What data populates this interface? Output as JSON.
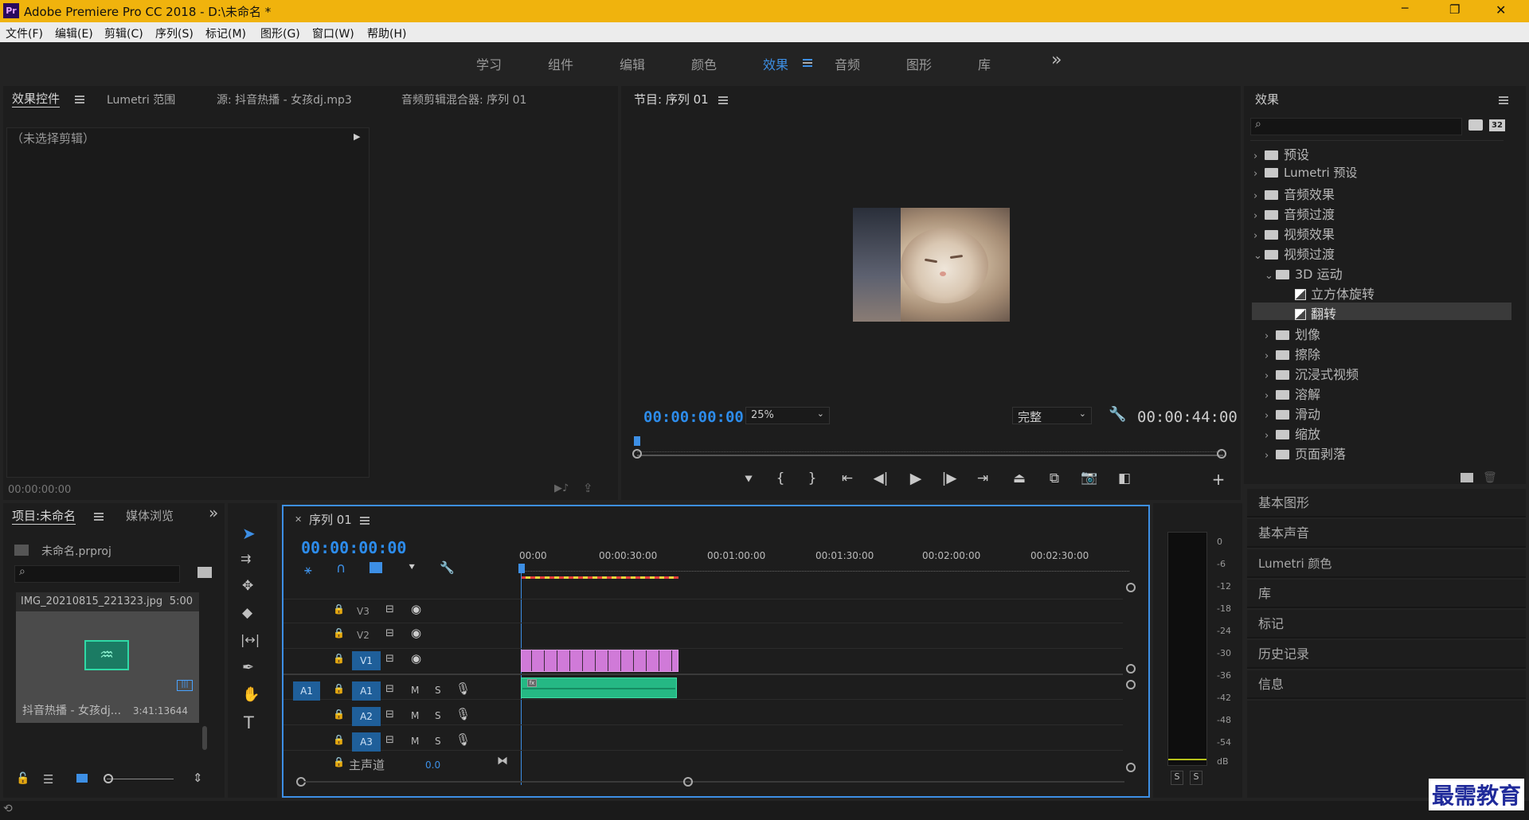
{
  "window": {
    "title": "Adobe Premiere Pro CC 2018 - D:\\未命名 *",
    "app_icon": "Pr",
    "controls": {
      "minimize": "─",
      "maximize": "❐",
      "close": "✕"
    }
  },
  "menu": [
    "文件(F)",
    "编辑(E)",
    "剪辑(C)",
    "序列(S)",
    "标记(M)",
    "图形(G)",
    "窗口(W)",
    "帮助(H)"
  ],
  "workspaces": {
    "items": [
      "学习",
      "组件",
      "编辑",
      "颜色",
      "效果",
      "音频",
      "图形",
      "库"
    ],
    "active": "效果",
    "more": "»"
  },
  "effect_controls": {
    "tabs": [
      "效果控件",
      "Lumetri 范围",
      "源: 抖音热播 - 女孩dj.mp3",
      "音频剪辑混合器: 序列 01"
    ],
    "no_clip": "（未选择剪辑）",
    "timecode": "00:00:00:00"
  },
  "program": {
    "title": "节目: 序列 01",
    "timecode": "00:00:00:00",
    "zoom": "25%",
    "quality": "完整",
    "duration": "00:00:44:00"
  },
  "effects_panel": {
    "title": "效果",
    "tree": [
      {
        "label": "预设",
        "level": 0,
        "type": "folder",
        "open": false
      },
      {
        "label": "Lumetri 预设",
        "level": 0,
        "type": "folder",
        "open": false
      },
      {
        "label": "音频效果",
        "level": 0,
        "type": "folder",
        "open": false
      },
      {
        "label": "音频过渡",
        "level": 0,
        "type": "folder",
        "open": false
      },
      {
        "label": "视频效果",
        "level": 0,
        "type": "folder",
        "open": false
      },
      {
        "label": "视频过渡",
        "level": 0,
        "type": "folder",
        "open": true
      },
      {
        "label": "3D 运动",
        "level": 1,
        "type": "folder",
        "open": true
      },
      {
        "label": "立方体旋转",
        "level": 2,
        "type": "effect"
      },
      {
        "label": "翻转",
        "level": 2,
        "type": "effect",
        "selected": true
      },
      {
        "label": "划像",
        "level": 1,
        "type": "folder",
        "open": false
      },
      {
        "label": "擦除",
        "level": 1,
        "type": "folder",
        "open": false
      },
      {
        "label": "沉浸式视频",
        "level": 1,
        "type": "folder",
        "open": false
      },
      {
        "label": "溶解",
        "level": 1,
        "type": "folder",
        "open": false
      },
      {
        "label": "滑动",
        "level": 1,
        "type": "folder",
        "open": false
      },
      {
        "label": "缩放",
        "level": 1,
        "type": "folder",
        "open": false
      },
      {
        "label": "页面剥落",
        "level": 1,
        "type": "folder",
        "open": false
      }
    ],
    "badges": [
      "32"
    ]
  },
  "side_panels": [
    "基本图形",
    "基本声音",
    "Lumetri 颜色",
    "库",
    "标记",
    "历史记录",
    "信息"
  ],
  "project": {
    "tabs": [
      "项目:未命名",
      "媒体浏览"
    ],
    "file": "未命名.prproj",
    "items": [
      {
        "name": "IMG_20210815_221323.jpg",
        "duration": "5:00"
      },
      {
        "name": "抖音热播 - 女孩dj...",
        "duration": "3:41:13644"
      }
    ]
  },
  "timeline": {
    "tab": "序列 01",
    "timecode": "00:00:00:00",
    "ruler": [
      "00:00",
      "00:00:30:00",
      "00:01:00:00",
      "00:01:30:00",
      "00:02:00:00",
      "00:02:30:00"
    ],
    "video_tracks": [
      "V3",
      "V2",
      "V1"
    ],
    "audio_tracks": [
      "A1",
      "A2",
      "A3"
    ],
    "src_patch": "A1",
    "master": "主声道",
    "master_value": "0.0",
    "m": "M",
    "s": "S"
  },
  "meter": {
    "labels": [
      "0",
      "-6",
      "-12",
      "-18",
      "-24",
      "-30",
      "-36",
      "-42",
      "-48",
      "-54",
      "dB"
    ],
    "solo": [
      "S",
      "S"
    ]
  },
  "watermark": "最需教育"
}
